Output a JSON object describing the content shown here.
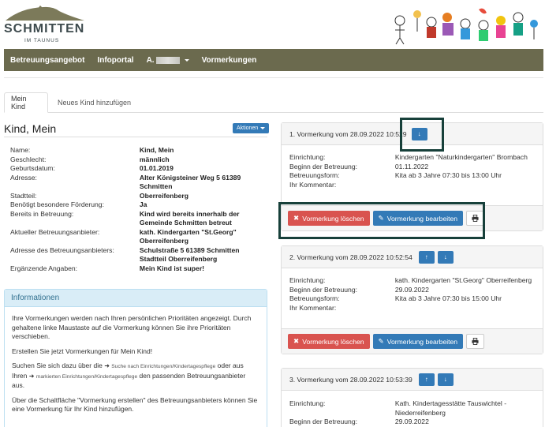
{
  "logo": {
    "title": "SCHMITTEN",
    "subtitle": "IM TAUNUS"
  },
  "nav": {
    "items": [
      "Betreuungsangebot",
      "Infoportal",
      "A.",
      "Vormerkungen"
    ]
  },
  "tabs": [
    "Mein Kind",
    "Neues Kind hinzufügen"
  ],
  "child": {
    "title": "Kind, Mein",
    "actions_label": "Aktionen",
    "fields": [
      {
        "k": "Name:",
        "v": "Kind, Mein"
      },
      {
        "k": "Geschlecht:",
        "v": "männlich"
      },
      {
        "k": "Geburtsdatum:",
        "v": "01.01.2019"
      },
      {
        "k": "Adresse:",
        "v": "Alter Königsteiner Weg 5 61389"
      },
      {
        "k": "",
        "v": "Schmitten"
      },
      {
        "k": "Stadtteil:",
        "v": "Oberreifenberg"
      },
      {
        "k": "Benötigt besondere Förderung:",
        "v": "Ja"
      },
      {
        "k": "Bereits in Betreuung:",
        "v": "Kind wird bereits innerhalb der"
      },
      {
        "k": "",
        "v": "Gemeinde Schmitten betreut"
      },
      {
        "k": "Aktueller Betreuungsanbieter:",
        "v": "kath. Kindergarten \"St.Georg\""
      },
      {
        "k": "",
        "v": "Oberreifenberg"
      },
      {
        "k": "Adresse des Betreuungsanbieters:",
        "v": "Schulstraße 5 61389 Schmitten"
      },
      {
        "k": "",
        "v": "Stadtteil Oberreifenberg"
      },
      {
        "k": "Ergänzende Angaben:",
        "v": "Mein Kind ist super!"
      }
    ]
  },
  "info": {
    "title": "Informationen",
    "p1": "Ihre Vormerkungen werden nach Ihren persönlichen Prioritäten angezeigt. Durch gehaltene linke Maustaste auf die Vormerkung können Sie ihre Prioritäten verschieben.",
    "p2": "Erstellen Sie jetzt Vormerkungen für Mein Kind!",
    "p3a": "Suchen Sie sich dazu über die",
    "link1": "Suche nach Einrichtungen/Kindertagespflege",
    "p3b": "oder aus Ihren",
    "link2": "markierten Einrichtungen/Kindertagespflege",
    "p3c": "den passenden Betreuungsanbieter aus.",
    "p4": "Über die Schaltfläche \"Vormerkung erstellen\" des Betreuungsanbieters können Sie eine Vormerkung für Ihr Kind hinzufügen."
  },
  "labels": {
    "einrichtung": "Einrichtung:",
    "beginn": "Beginn der Betreuung:",
    "form": "Betreuungsform:",
    "kommentar": "Ihr Kommentar:",
    "delete": "Vormerkung löschen",
    "edit": "Vormerkung bearbeiten"
  },
  "vormerkungen": [
    {
      "title": "1. Vormerkung vom 28.09.2022 10:5",
      "title_end": "29",
      "einrichtung": "Kindergarten \"Naturkindergarten\" Brombach",
      "beginn": "01.11.2022",
      "form": "Kita ab 3 Jahre 07:30 bis 13:00 Uhr",
      "kommentar": ""
    },
    {
      "title": "2. Vormerkung vom 28.09.2022 10:52:54",
      "einrichtung": "kath. Kindergarten \"St.Georg\" Oberreifenberg",
      "beginn": "29.09.2022",
      "form": "Kita ab 3 Jahre 07:30 bis 15:00 Uhr",
      "kommentar": ""
    },
    {
      "title": "3. Vormerkung vom 28.09.2022 10:53:39",
      "einrichtung": "Kath. Kindertagesstätte Tauswichtel -",
      "einrichtung2": "Niederreifenberg",
      "beginn": "29.09.2022"
    }
  ]
}
